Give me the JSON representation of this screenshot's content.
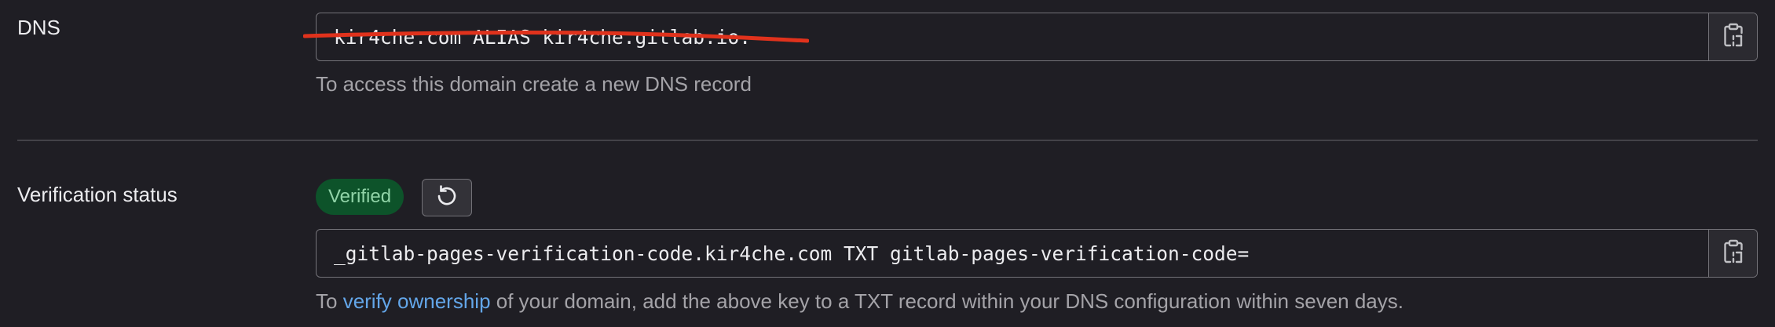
{
  "dns": {
    "label": "DNS",
    "record": "kir4che.com ALIAS kir4che.gitlab.io.",
    "helper": "To access this domain create a new DNS record"
  },
  "verification": {
    "label": "Verification status",
    "badge": "Verified",
    "record": "_gitlab-pages-verification-code.kir4che.com TXT gitlab-pages-verification-code=",
    "helper_prefix": "To ",
    "helper_link": "verify ownership",
    "helper_suffix": " of your domain, add the above key to a TXT record within your DNS configuration within seven days."
  },
  "icons": {
    "copy": "copy-to-clipboard-icon",
    "retry": "retry-icon"
  },
  "colors": {
    "background": "#1f1e24",
    "verified_badge_bg": "#0d532a",
    "verified_badge_text": "#91d4a8",
    "link": "#63a6e9",
    "strike_annotation": "#e0321c"
  }
}
